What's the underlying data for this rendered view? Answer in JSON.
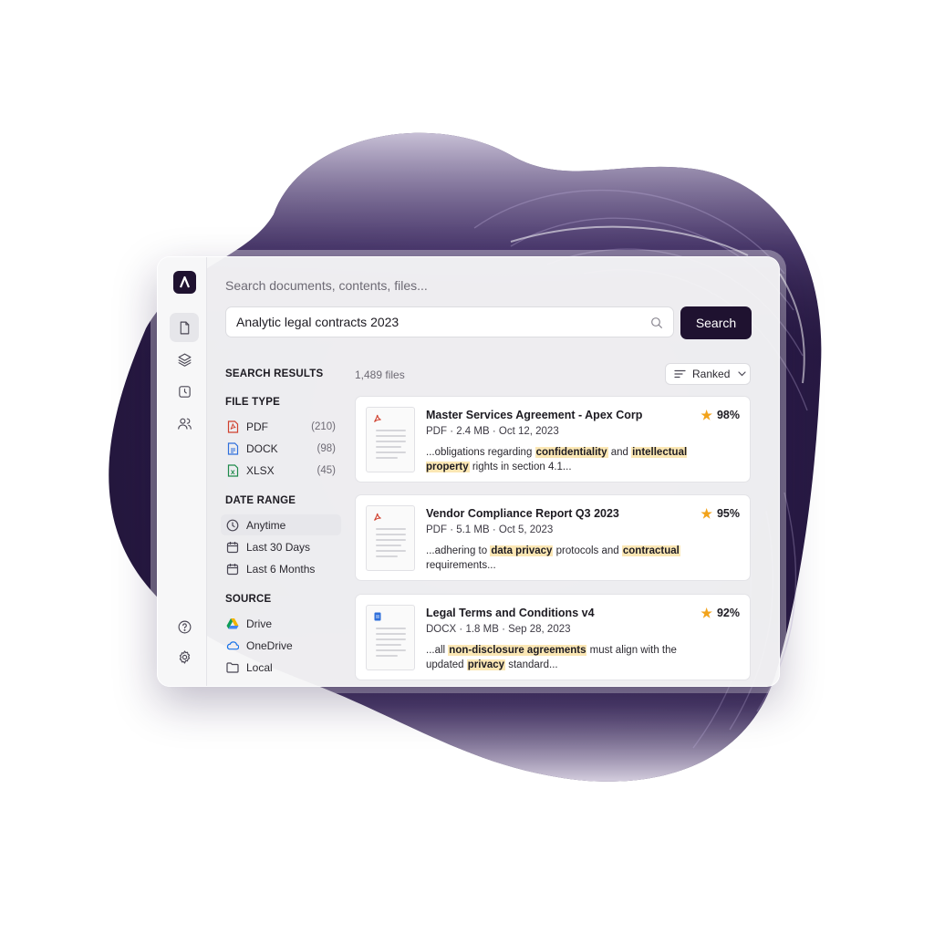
{
  "app": {
    "search_hint": "Search documents, contents, files...",
    "query": "Analytic legal contracts 2023",
    "search_button": "Search",
    "brand_color": "#1f1230",
    "highlight_color": "#fbe7b4"
  },
  "rail": {
    "items": [
      {
        "icon": "document-icon",
        "active": true
      },
      {
        "icon": "layers-icon",
        "active": false
      },
      {
        "icon": "history-icon",
        "active": false
      },
      {
        "icon": "users-icon",
        "active": false
      }
    ],
    "bottom": [
      {
        "icon": "help-icon"
      },
      {
        "icon": "gear-icon"
      }
    ]
  },
  "sidebar": {
    "heading": "SEARCH RESULTS",
    "file_type": {
      "title": "FILE TYPE",
      "items": [
        {
          "label": "PDF",
          "count": "(210)",
          "icon": "pdf-file-icon"
        },
        {
          "label": "DOCK",
          "count": "(98)",
          "icon": "doc-file-icon"
        },
        {
          "label": "XLSX",
          "count": "(45)",
          "icon": "xlsx-file-icon"
        }
      ]
    },
    "date_range": {
      "title": "DATE RANGE",
      "items": [
        {
          "label": "Anytime",
          "icon": "clock-icon",
          "selected": true
        },
        {
          "label": "Last 30 Days",
          "icon": "calendar-icon",
          "selected": false
        },
        {
          "label": "Last 6 Months",
          "icon": "calendar-icon",
          "selected": false
        }
      ]
    },
    "source": {
      "title": "SOURCE",
      "items": [
        {
          "label": "Drive",
          "icon": "google-drive-icon"
        },
        {
          "label": "OneDrive",
          "icon": "onedrive-cloud-icon"
        },
        {
          "label": "Local",
          "icon": "folder-icon"
        }
      ]
    }
  },
  "results": {
    "count": "1,489 files",
    "sort_label": "Ranked",
    "items": [
      {
        "title": "Master Services Agreement - Apex Corp",
        "meta": "PDF · 2.4 MB · Oct 12, 2023",
        "score": "98%",
        "type": "pdf",
        "snippet": [
          {
            "t": "...obligations regarding ",
            "h": false
          },
          {
            "t": "confidentiality",
            "h": true
          },
          {
            "t": " and ",
            "h": false
          },
          {
            "t": "intellectual property",
            "h": true
          },
          {
            "t": " rights in section 4.1...",
            "h": false
          }
        ]
      },
      {
        "title": "Vendor Compliance Report Q3 2023",
        "meta": "PDF · 5.1 MB · Oct 5, 2023",
        "score": "95%",
        "type": "pdf",
        "snippet": [
          {
            "t": "...adhering to ",
            "h": false
          },
          {
            "t": "data privacy",
            "h": true
          },
          {
            "t": " protocols and ",
            "h": false
          },
          {
            "t": "contractual",
            "h": true
          },
          {
            "t": " requirements...",
            "h": false
          }
        ]
      },
      {
        "title": "Legal Terms and Conditions v4",
        "meta": "DOCX · 1.8 MB · Sep 28, 2023",
        "score": "92%",
        "type": "docx",
        "snippet": [
          {
            "t": "...all ",
            "h": false
          },
          {
            "t": "non-disclosure agreements",
            "h": true
          },
          {
            "t": " must align with the updated ",
            "h": false
          },
          {
            "t": "privacy",
            "h": true
          },
          {
            "t": " standard...",
            "h": false
          }
        ]
      }
    ]
  }
}
